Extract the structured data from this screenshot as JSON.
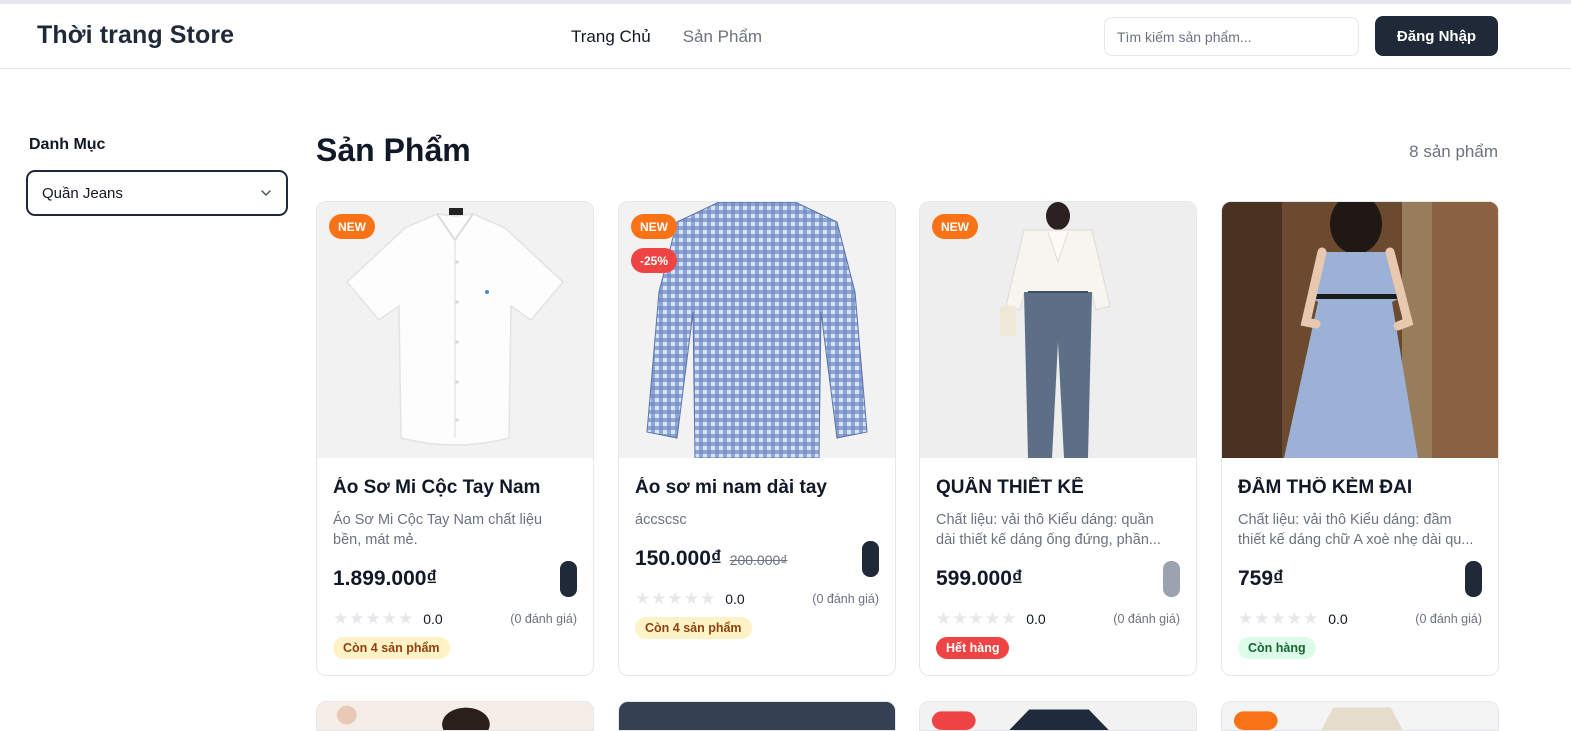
{
  "header": {
    "brand": "Thời trang Store",
    "nav": [
      {
        "label": "Trang Chủ"
      },
      {
        "label": "Sản Phẩm"
      }
    ],
    "search_placeholder": "Tìm kiếm sản phẩm...",
    "login_label": "Đăng Nhập"
  },
  "sidebar": {
    "title": "Danh Mục",
    "selected_category": "Quần Jeans"
  },
  "main": {
    "title": "Sản Phẩm",
    "count_text": "8 sản phẩm",
    "products": [
      {
        "name": "Áo Sơ Mi Cộc Tay Nam",
        "description": "Áo Sơ Mi Cộc Tay Nam chất liệu bền, mát mẻ.",
        "price": "1.899.000₫",
        "old_price": "",
        "badges": [
          "NEW"
        ],
        "rating": "0.0",
        "reviews": "(0 đánh giá)",
        "stock_label": "Còn 4 sản phẩm",
        "stock_state": "low",
        "cart_enabled": true
      },
      {
        "name": "Áo sơ mi nam dài tay",
        "description": "ácсscsc",
        "price": "150.000₫",
        "old_price": "200.000₫",
        "badges": [
          "NEW",
          "-25%"
        ],
        "rating": "0.0",
        "reviews": "(0 đánh giá)",
        "stock_label": "Còn 4 sản phẩm",
        "stock_state": "low",
        "cart_enabled": true
      },
      {
        "name": "QUẦN THIẾT KẾ",
        "description": "Chất liệu: vải thô Kiểu dáng: quần dài thiết kế dáng ống đứng, phần...",
        "price": "599.000₫",
        "old_price": "",
        "badges": [
          "NEW"
        ],
        "rating": "0.0",
        "reviews": "(0 đánh giá)",
        "stock_label": "Hết hàng",
        "stock_state": "out",
        "cart_enabled": false
      },
      {
        "name": "ĐẦM THÔ KÈM ĐAI",
        "description": "Chất liệu: vải thô Kiểu dáng: đầm thiết kế dáng chữ A xoè nhẹ dài qu...",
        "price": "759₫",
        "old_price": "",
        "badges": [],
        "rating": "0.0",
        "reviews": "(0 đánh giá)",
        "stock_label": "Còn hàng",
        "stock_state": "in",
        "cart_enabled": true
      }
    ]
  },
  "icons": {
    "select_chevron": "chevron-down-icon",
    "star": "star-icon"
  },
  "colors": {
    "primary": "#1f2937",
    "new_badge": "#f97316",
    "sale_badge": "#ef4444",
    "muted_text": "#6b7280"
  }
}
